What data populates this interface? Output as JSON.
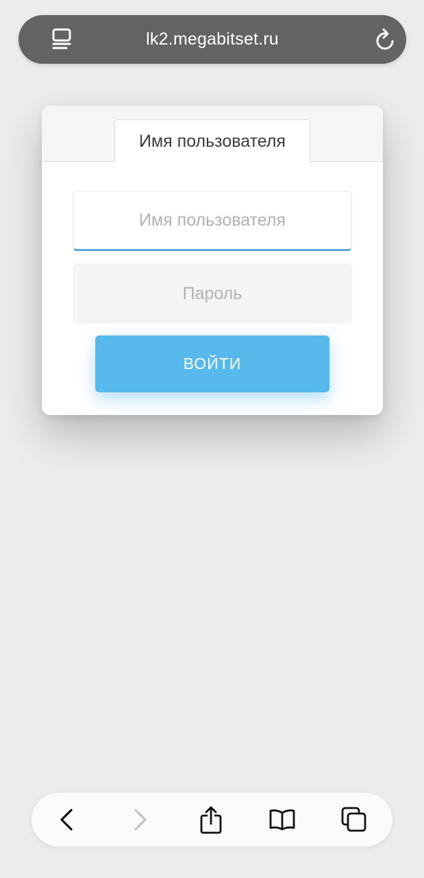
{
  "browser": {
    "url": "lk2.megabitset.ru",
    "reader_icon": "reader-view-icon",
    "reload_icon": "reload-icon"
  },
  "login": {
    "tab_label": "Имя пользователя",
    "username_placeholder": "Имя пользователя",
    "username_value": "",
    "password_placeholder": "Пароль",
    "password_value": "",
    "submit_label": "ВОЙТИ"
  },
  "toolbar": {
    "items": [
      {
        "icon": "back-chevron-icon",
        "enabled": true
      },
      {
        "icon": "forward-chevron-icon",
        "enabled": false
      },
      {
        "icon": "share-icon",
        "enabled": true
      },
      {
        "icon": "bookmarks-book-icon",
        "enabled": true
      },
      {
        "icon": "tabs-icon",
        "enabled": true
      }
    ]
  },
  "colors": {
    "background": "#ececec",
    "address_bar": "#636363",
    "accent": "#58b9ec",
    "input_focus_underline": "#5aa8d8"
  }
}
